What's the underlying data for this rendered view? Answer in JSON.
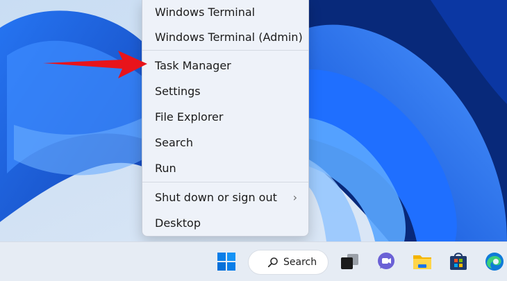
{
  "context_menu": {
    "items": [
      {
        "label": "Windows Terminal"
      },
      {
        "label": "Windows Terminal (Admin)"
      },
      {
        "label": "Task Manager"
      },
      {
        "label": "Settings"
      },
      {
        "label": "File Explorer"
      },
      {
        "label": "Search"
      },
      {
        "label": "Run"
      },
      {
        "label": "Shut down or sign out",
        "submenu_icon": "chevron-right-icon"
      },
      {
        "label": "Desktop"
      }
    ]
  },
  "annotation": {
    "icon": "red-arrow-icon",
    "color": "#e8141b"
  },
  "taskbar": {
    "start_icon": "windows-logo-icon",
    "search_label": "Search",
    "apps": [
      "task-view-icon",
      "teams-chat-icon",
      "file-explorer-icon",
      "microsoft-store-icon",
      "edge-icon"
    ]
  },
  "colors": {
    "accent": "#0a5fd6",
    "menu_bg": "#eef2f9",
    "taskbar_bg": "#e6ecf4"
  }
}
